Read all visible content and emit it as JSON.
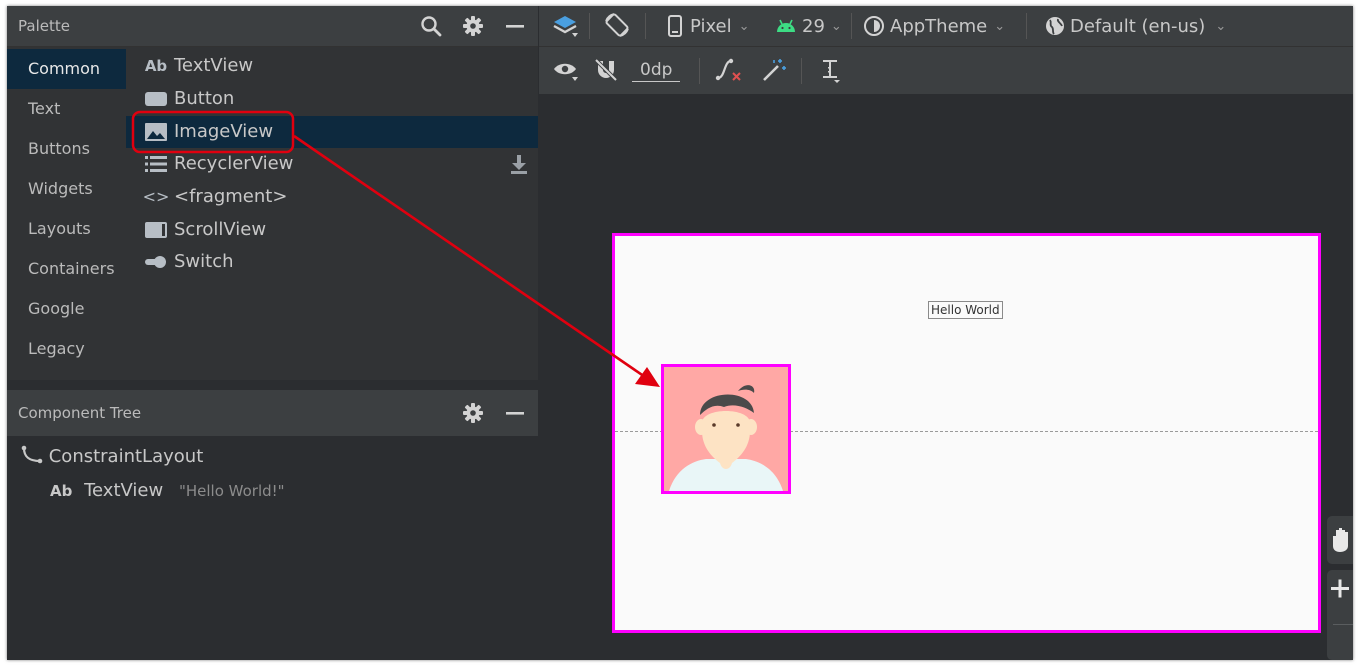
{
  "palette": {
    "title": "Palette",
    "categories": [
      {
        "label": "Common"
      },
      {
        "label": "Text"
      },
      {
        "label": "Buttons"
      },
      {
        "label": "Widgets"
      },
      {
        "label": "Layouts"
      },
      {
        "label": "Containers"
      },
      {
        "label": "Google"
      },
      {
        "label": "Legacy"
      }
    ],
    "selected_category": "Common",
    "items": [
      {
        "label": "TextView",
        "icon": "ab-text-icon",
        "icon_text": "Ab"
      },
      {
        "label": "Button",
        "icon": "button-icon"
      },
      {
        "label": "ImageView",
        "icon": "image-icon"
      },
      {
        "label": "RecyclerView",
        "icon": "list-icon"
      },
      {
        "label": "<fragment>",
        "icon": "code-brackets-icon",
        "icon_text": "<>"
      },
      {
        "label": "ScrollView",
        "icon": "scrollview-icon"
      },
      {
        "label": "Switch",
        "icon": "switch-icon"
      }
    ],
    "selected_item": "ImageView",
    "header_icons": [
      "search-icon",
      "gear-icon",
      "minimize-icon"
    ]
  },
  "component_tree": {
    "title": "Component Tree",
    "root": {
      "label": "ConstraintLayout",
      "icon": "constraint-layout-icon"
    },
    "children": [
      {
        "label": "TextView",
        "icon_text": "Ab",
        "value": "\"Hello World!\""
      }
    ]
  },
  "design_toolbar": {
    "device": "Pixel",
    "api_level": "29",
    "theme": "AppTheme",
    "locale": "Default (en-us)",
    "default_margin": "0dp",
    "icons": [
      "layers-icon",
      "rotate-icon",
      "phone-icon",
      "android-icon",
      "theme-icon",
      "globe-icon",
      "eye-icon",
      "magnet-off-icon",
      "clear-constraints-icon",
      "infer-constraints-icon",
      "guidelines-icon"
    ]
  },
  "canvas": {
    "hello_world_text": "Hello World",
    "image_content": "avatar-illustration",
    "side_icons": [
      "hand-pan-icon",
      "zoom-in-icon"
    ]
  },
  "annotations": {
    "highlight_color": "#e0000f",
    "arrow_color": "#e0000f",
    "selection_color": "#ff00ff"
  },
  "colors": {
    "panel_bg": "#3c3f41",
    "selected_bg": "#0d293e",
    "avatar_bg": "#ffa8a5",
    "android_green": "#3ddc84",
    "toolbar_accent": "#4a9fe0"
  }
}
